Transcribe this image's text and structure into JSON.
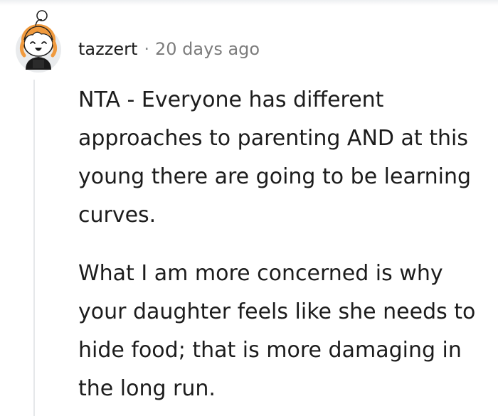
{
  "comment": {
    "author": "tazzert",
    "separator": "·",
    "timestamp": "20 days ago",
    "avatar_icon": "snoo-avatar-icon",
    "paragraphs": [
      "NTA - Everyone has different approaches to parenting AND at this young there are going to be learning curves.",
      "What I am more concerned is why your daughter feels like she needs to hide food; that is more damaging in the long run."
    ]
  }
}
